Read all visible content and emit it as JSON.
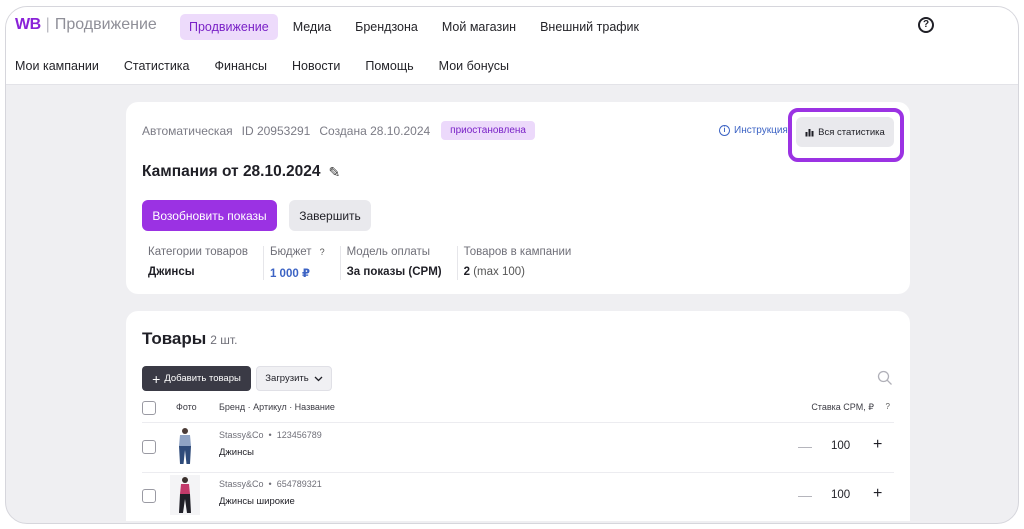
{
  "header": {
    "logo_wb": "WB",
    "logo_name": "Продвижение",
    "main_nav": [
      "Продвижение",
      "Медиа",
      "Брендзона",
      "Мой магазин",
      "Внешний трафик"
    ],
    "help_icon": "?"
  },
  "sub_nav": [
    "Мои кампании",
    "Статистика",
    "Финансы",
    "Новости",
    "Помощь",
    "Мои бонусы"
  ],
  "campaign": {
    "type": "Автоматическая",
    "id": "ID 20953291",
    "created": "Создана 28.10.2024",
    "status": "приостановлена",
    "instruction_link": "Инструкция",
    "all_stats_button": "Вся статистика",
    "title": "Кампания от 28.10.2024",
    "resume_button": "Возобновить показы",
    "finish_button": "Завершить",
    "stats": {
      "categories_label": "Категории товаров",
      "categories_value": "Джинсы",
      "budget_label": "Бюджет",
      "budget_value": "1 000 ₽",
      "payment_label": "Модель оплаты",
      "payment_value": "За показы (CPM)",
      "goods_label": "Товаров в кампании",
      "goods_value": "2",
      "goods_max": "(max 100)"
    }
  },
  "products": {
    "title": "Товары",
    "count": "2 шт.",
    "add_button": "Добавить товары",
    "load_button": "Загрузить",
    "columns": {
      "photo": "Фото",
      "brand": "Бренд · Артикул · Название",
      "rate": "Ставка CPM, ₽"
    },
    "rows": [
      {
        "brand": "Stassy&Co",
        "article": "123456789",
        "name": "Джинсы",
        "rate": "100"
      },
      {
        "brand": "Stassy&Co",
        "article": "654789321",
        "name": "Джинсы широкие",
        "rate": "100"
      }
    ]
  },
  "colors": {
    "accent": "#9b32e3",
    "accent_soft": "#eddbfb",
    "link_blue": "#3c63c4",
    "dark_button": "#3a3a45"
  }
}
